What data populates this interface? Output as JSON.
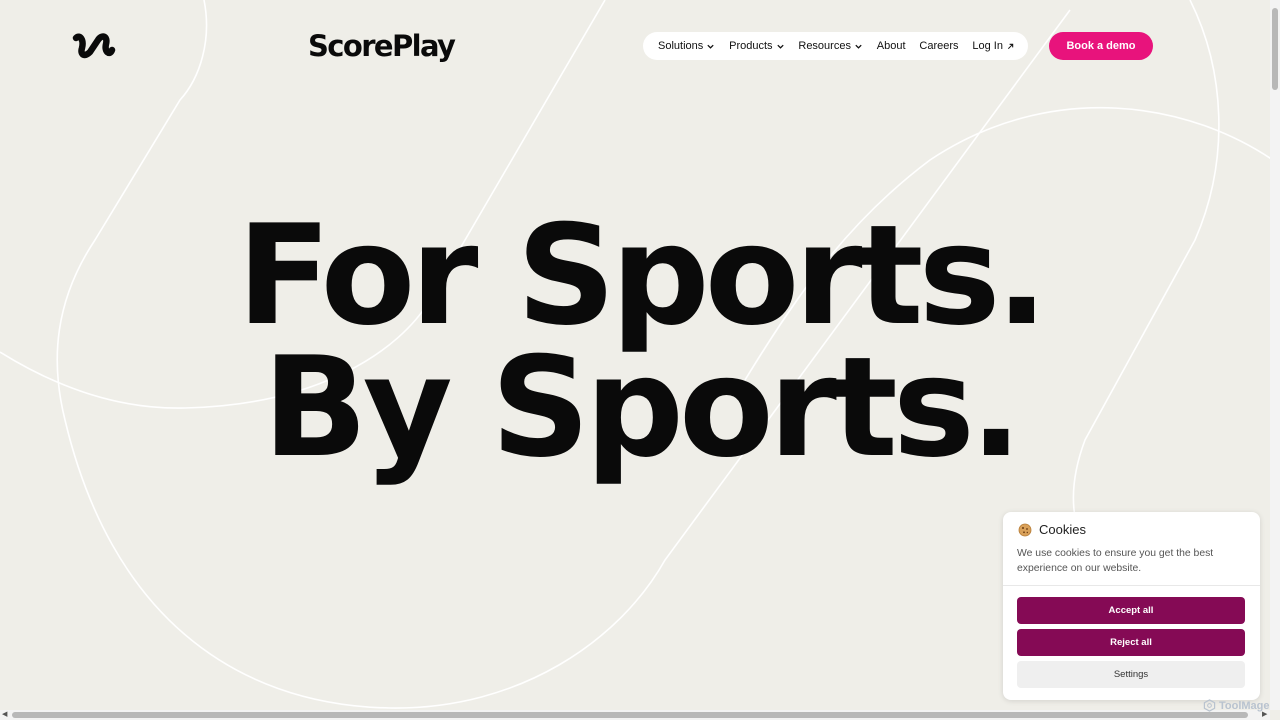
{
  "brand": {
    "name": "ScorePlay",
    "logo_icon": "scoreplay-wave-icon"
  },
  "nav": {
    "items": [
      {
        "label": "Solutions",
        "icon": "chevron-down-icon"
      },
      {
        "label": "Products",
        "icon": "chevron-down-icon"
      },
      {
        "label": "Resources",
        "icon": "chevron-down-icon"
      },
      {
        "label": "About"
      },
      {
        "label": "Careers"
      },
      {
        "label": "Log In",
        "icon": "external-arrow-icon"
      }
    ],
    "cta_label": "Book a demo"
  },
  "hero": {
    "line1": "For Sports.",
    "line2": "By Sports."
  },
  "cookie_banner": {
    "icon": "cookie-icon",
    "title": "Cookies",
    "text": "We use cookies to ensure you get the best experience on our website.",
    "accept_label": "Accept all",
    "reject_label": "Reject all",
    "settings_label": "Settings"
  },
  "watermark": {
    "text": "ToolMage"
  },
  "colors": {
    "background": "#efeee8",
    "accent": "#e8137c",
    "cookie_button": "#850a55",
    "text": "#0a0a0a"
  }
}
